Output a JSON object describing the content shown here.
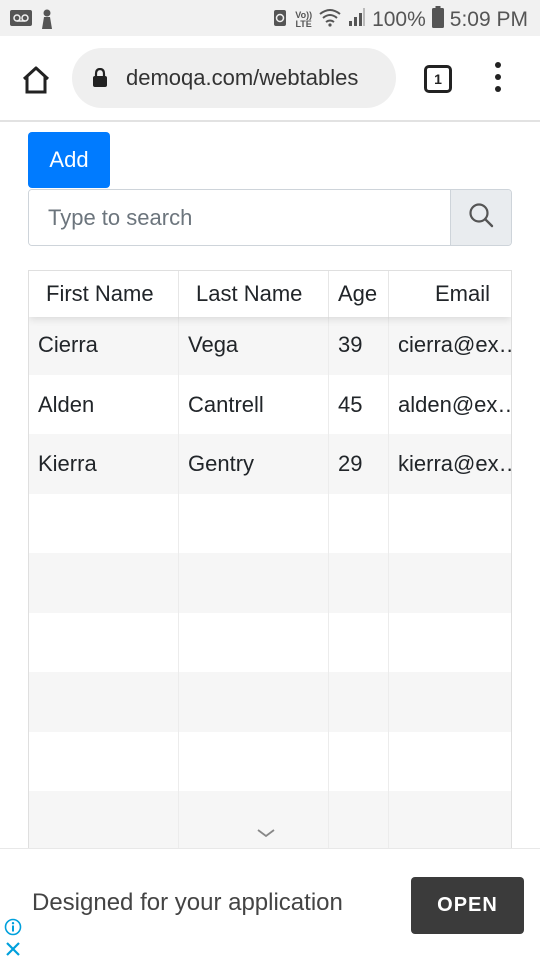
{
  "status_bar": {
    "battery_pct": "100%",
    "time": "5:09 PM",
    "network_top": "Vo))",
    "network_bottom": "LTE",
    "icons": [
      "voicemail-icon",
      "profile-icon",
      "alarm-icon",
      "wifi-icon",
      "signal-icon",
      "battery-icon"
    ]
  },
  "browser": {
    "url": "demoqa.com/webtables",
    "tab_count": "1",
    "icons": [
      "home-icon",
      "lock-icon",
      "tabs-icon",
      "more-vert-icon"
    ]
  },
  "add_button": {
    "label": "Add"
  },
  "search": {
    "placeholder": "Type to search",
    "value": "",
    "icon": "search-icon"
  },
  "table": {
    "headers": [
      "First Name",
      "Last Name",
      "Age",
      "Email"
    ],
    "rows": [
      [
        "Cierra",
        "Vega",
        "39",
        "cierra@ex…"
      ],
      [
        "Alden",
        "Cantrell",
        "45",
        "alden@ex…"
      ],
      [
        "Kierra",
        "Gentry",
        "29",
        "kierra@ex…"
      ],
      [
        "",
        "",
        "",
        ""
      ],
      [
        "",
        "",
        "",
        ""
      ],
      [
        "",
        "",
        "",
        ""
      ],
      [
        "",
        "",
        "",
        ""
      ],
      [
        "",
        "",
        "",
        ""
      ],
      [
        "",
        "",
        "",
        ""
      ]
    ]
  },
  "ad": {
    "text": "Designed for your application",
    "open_label": "OPEN",
    "icons": [
      "info-icon",
      "close-icon"
    ]
  },
  "colors": {
    "primary": "#007bff",
    "ad_button": "#3b3b3b",
    "ad_icon": "#00a0dc"
  }
}
